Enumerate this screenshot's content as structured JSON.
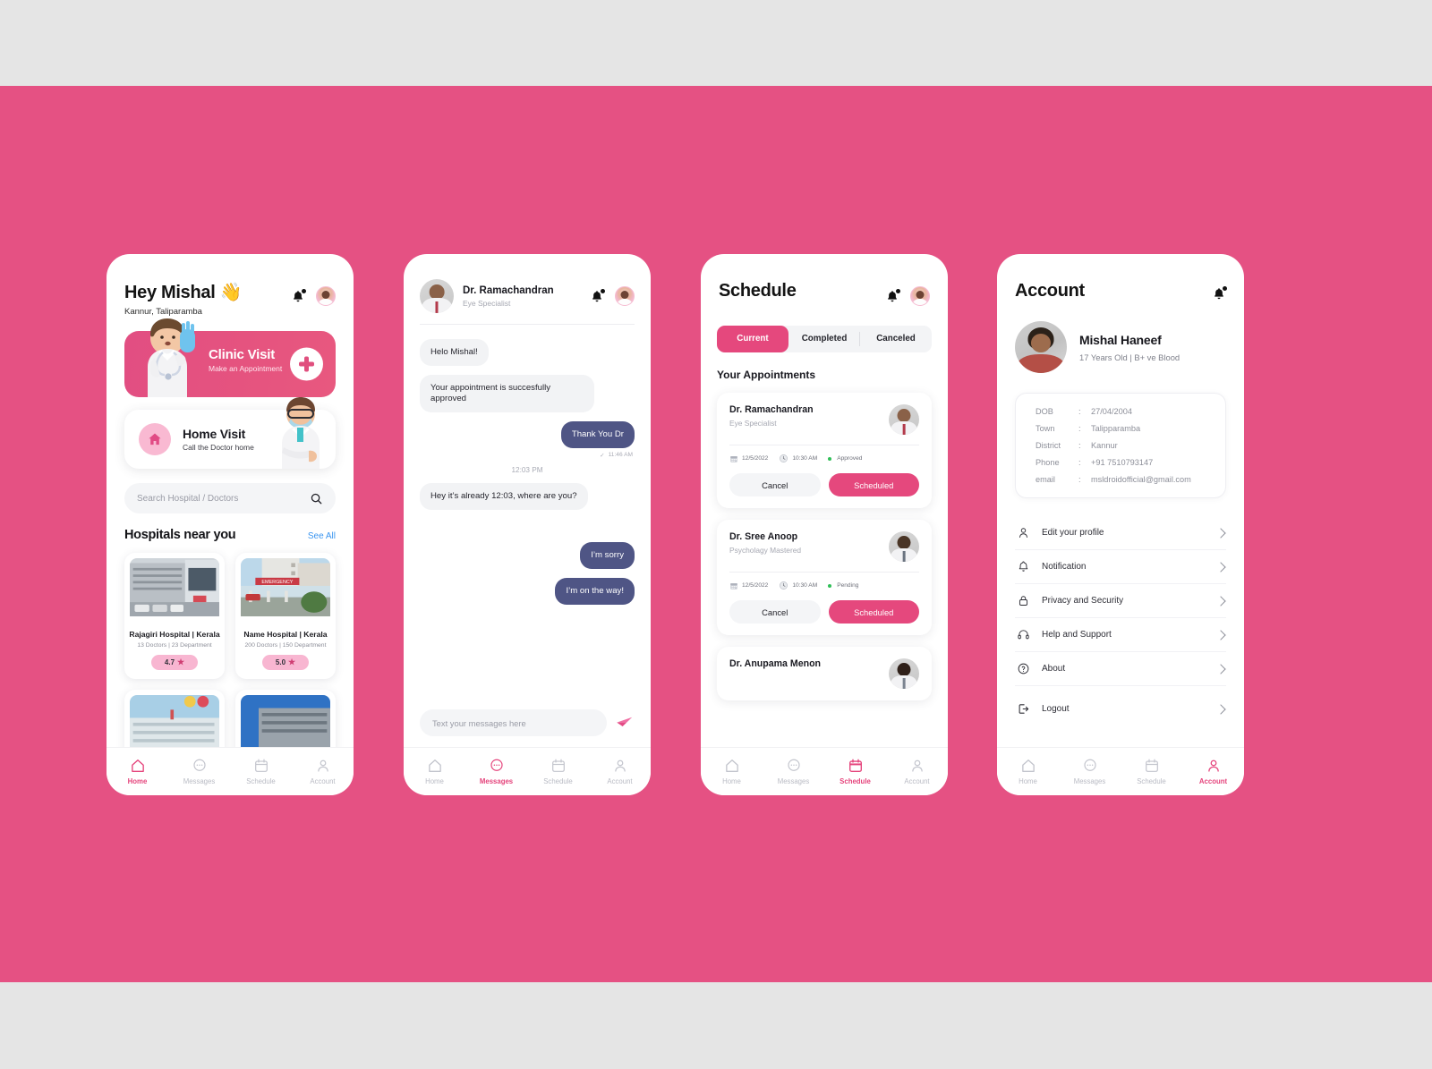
{
  "theme": {
    "background": "#e5e5e5",
    "band": "#e55183",
    "accent": "#e5487d",
    "accent_soft": "#f8b6d1",
    "chat_out": "#4f5585",
    "link": "#3a95f0",
    "status_green": "#2fbf57"
  },
  "home": {
    "greeting": "Hey Mishal 👋",
    "location": "Kannur, Taliparamba",
    "bell_icon": "bell-icon",
    "avatar_icon": "user-avatar",
    "clinic": {
      "title": "Clinic Visit",
      "subtitle": "Make an Appointment",
      "action_icon": "plus-icon"
    },
    "home_visit": {
      "title": "Home Visit",
      "subtitle": "Call the Doctor home",
      "icon": "home-icon"
    },
    "search": {
      "placeholder": "Search Hospital / Doctors",
      "icon": "search-icon"
    },
    "section": {
      "title": "Hospitals near you",
      "see_all": "See All"
    },
    "hospitals": [
      {
        "name": "Rajagiri Hospital | Kerala",
        "meta": "13 Doctors | 23 Department",
        "rating": "4.7"
      },
      {
        "name": "Name Hospital | Kerala",
        "meta": "200 Doctors | 150 Department",
        "rating": "5.0"
      }
    ]
  },
  "messages": {
    "doctor_name": "Dr. Ramachandran",
    "doctor_role": "Eye Specialist",
    "bubbles": [
      {
        "dir": "in",
        "text": "Helo Mishal!"
      },
      {
        "dir": "in",
        "text": "Your appointment is succesfully approved"
      },
      {
        "dir": "out",
        "text": "Thank You Dr",
        "time": "11:46 AM",
        "tick": "✓"
      }
    ],
    "time_separator": "12:03 PM",
    "bubbles2": [
      {
        "dir": "in",
        "text": "Hey it’s already 12:03, where are you?"
      },
      {
        "dir": "out",
        "text": "I’m sorry"
      },
      {
        "dir": "out",
        "text": "I’m on the way!"
      }
    ],
    "input": {
      "placeholder": "Text your messages here",
      "send_icon": "send-icon"
    }
  },
  "schedule": {
    "title": "Schedule",
    "tabs": [
      {
        "label": "Current",
        "active": true
      },
      {
        "label": "Completed",
        "active": false
      },
      {
        "label": "Canceled",
        "active": false
      }
    ],
    "section_title": "Your Appointments",
    "appointments": [
      {
        "name": "Dr. Ramachandran",
        "role": "Eye Specialist",
        "date": "12/5/2022",
        "time": "10:30 AM",
        "status": "Approved",
        "cancel": "Cancel",
        "primary": "Scheduled"
      },
      {
        "name": "Dr. Sree Anoop",
        "role": "Psycholagy Mastered",
        "date": "12/5/2022",
        "time": "10:30 AM",
        "status": "Pending",
        "cancel": "Cancel",
        "primary": "Scheduled"
      },
      {
        "name": "Dr. Anupama Menon",
        "role": "",
        "date": "",
        "time": "",
        "status": "",
        "cancel": "",
        "primary": ""
      }
    ]
  },
  "account": {
    "title": "Account",
    "name": "Mishal Haneef",
    "subtitle": "17 Years Old |  B+ ve Blood",
    "info": [
      {
        "key": "DOB",
        "value": "27/04/2004"
      },
      {
        "key": "Town",
        "value": "Talipparamba"
      },
      {
        "key": "District",
        "value": "Kannur"
      },
      {
        "key": "Phone",
        "value": "+91 7510793147"
      },
      {
        "key": "email",
        "value": "msldroidofficial@gmail.com"
      }
    ],
    "menu": [
      {
        "label": "Edit your profile",
        "icon": "person-icon"
      },
      {
        "label": "Notification",
        "icon": "bell-icon"
      },
      {
        "label": "Privacy and Security",
        "icon": "lock-icon"
      },
      {
        "label": "Help and Support",
        "icon": "headset-icon"
      },
      {
        "label": "About",
        "icon": "question-circle-icon"
      },
      {
        "label": "Logout",
        "icon": "logout-icon"
      }
    ]
  },
  "nav": {
    "items": [
      {
        "label": "Home",
        "icon": "home-icon"
      },
      {
        "label": "Messages",
        "icon": "chat-icon"
      },
      {
        "label": "Schedule",
        "icon": "calendar-icon"
      },
      {
        "label": "Account",
        "icon": "person-icon"
      }
    ]
  }
}
